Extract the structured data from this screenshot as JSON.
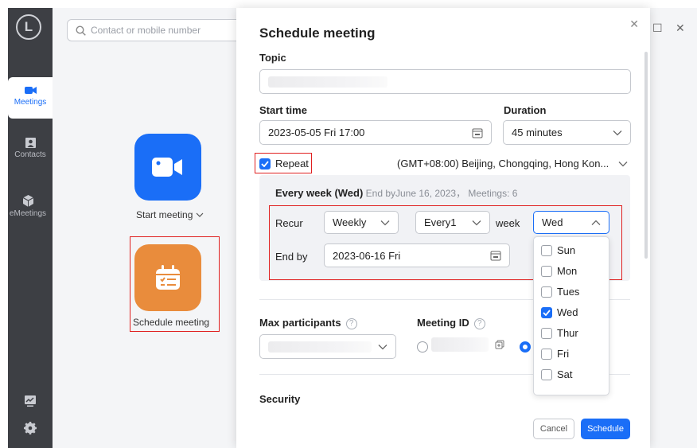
{
  "rail": {
    "logo": "L",
    "items": [
      {
        "label": "Meetings"
      },
      {
        "label": "Contacts"
      },
      {
        "label": "eMeetings"
      }
    ]
  },
  "main": {
    "search_placeholder": "Contact or mobile number",
    "start_meeting_label": "Start meeting",
    "schedule_meeting_label": "Schedule meeting"
  },
  "dialog": {
    "title": "Schedule meeting",
    "topic_label": "Topic",
    "start_time_label": "Start time",
    "start_time_value": "2023-05-05  Fri 17:00",
    "duration_label": "Duration",
    "duration_value": "45 minutes",
    "repeat_label": "Repeat",
    "timezone_value": "(GMT+08:00) Beijing, Chongqing, Hong Kon...",
    "summary_bold": "Every week (Wed)",
    "summary_rest": " End byJune 16, 2023， Meetings: 6",
    "recur_label": "Recur",
    "recur_value": "Weekly",
    "every_value": "Every1",
    "week_label": "week",
    "day_value": "Wed",
    "end_by_label": "End by",
    "end_by_value": "2023-06-16  Fri",
    "days": [
      {
        "label": "Sun",
        "checked": false
      },
      {
        "label": "Mon",
        "checked": false
      },
      {
        "label": "Tues",
        "checked": false
      },
      {
        "label": "Wed",
        "checked": true
      },
      {
        "label": "Thur",
        "checked": false
      },
      {
        "label": "Fri",
        "checked": false
      },
      {
        "label": "Sat",
        "checked": false
      }
    ],
    "max_participants_label": "Max participants",
    "meeting_id_label": "Meeting ID",
    "help_glyph": "?",
    "security_label": "Security",
    "cancel_label": "Cancel",
    "schedule_label": "Schedule"
  },
  "colors": {
    "accent": "#1a6ef7",
    "highlight": "#e02020",
    "orange": "#e98c3c"
  }
}
